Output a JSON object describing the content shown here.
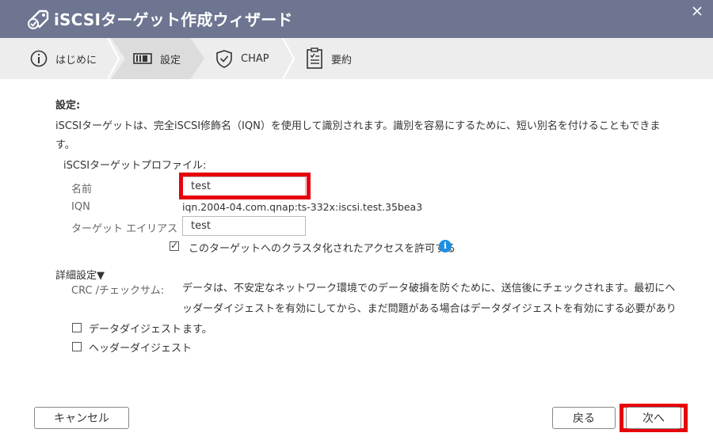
{
  "window": {
    "title": "iSCSIターゲット作成ウィザード"
  },
  "steps": [
    {
      "label": "はじめに",
      "icon": "info-circle-icon"
    },
    {
      "label": "設定",
      "icon": "settings-bars-icon"
    },
    {
      "label": "CHAP",
      "icon": "shield-check-icon"
    },
    {
      "label": "要約",
      "icon": "clipboard-check-icon"
    }
  ],
  "settings": {
    "heading": "設定:",
    "description": "iSCSIターゲットは、完全iSCSI修飾名（IQN）を使用して識別されます。識別を容易にするために、短い別名を付けることもできます。",
    "profile_title": "iSCSIターゲットプロファイル:",
    "name_label": "名前",
    "name_value": "test",
    "iqn_label": "IQN",
    "iqn_value": "iqn.2004-04.com.qnap:ts-332x:iscsi.test.35bea3",
    "alias_label": "ターゲット エイリアス",
    "alias_value": "test",
    "cluster_access_label": "このターゲットへのクラスタ化されたアクセスを許可する",
    "cluster_access_checked": true
  },
  "advanced": {
    "title": "詳細設定▼",
    "crc_label": "CRC /チェックサム:",
    "crc_description": "データは、不安定なネットワーク環境でのデータ破損を防ぐために、送信後にチェックされます。最初にヘッダーダイジェストを有効にしてから、まだ問題がある場合はデータダイジェストを有効にする必要があります。",
    "data_digest_label": "データダイジェスト",
    "data_digest_checked": false,
    "header_digest_label": "ヘッダーダイジェスト",
    "header_digest_checked": false
  },
  "footer": {
    "cancel_label": "キャンセル",
    "back_label": "戻る",
    "next_label": "次へ"
  },
  "colors": {
    "titlebar": "#6d7591",
    "highlight": "#e8000b",
    "info": "#1d8fe1"
  }
}
